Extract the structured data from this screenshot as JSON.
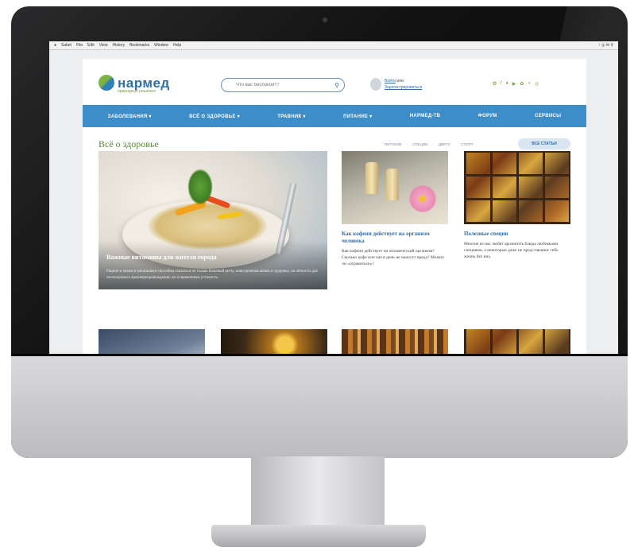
{
  "menubar": {
    "items": [
      "Safari",
      "File",
      "Edit",
      "View",
      "History",
      "Bookmarks",
      "Window",
      "Help"
    ]
  },
  "header": {
    "logo": "нармед",
    "logo_sub": "природные решения",
    "search_placeholder": "Что вас беспокоит?",
    "login": "Войти",
    "or": "или",
    "register": "Зарегистрироваться",
    "social_icons": [
      "odnoklassniki-icon",
      "facebook-icon",
      "twitter-icon",
      "youtube-icon",
      "vk-icon",
      "rss-icon",
      "instagram-icon"
    ]
  },
  "nav": {
    "items": [
      "ЗАБОЛЕВАНИЯ ▾",
      "ВСЁ О ЗДОРОВЬЕ ▾",
      "ТРАВНИК ▾",
      "ПИТАНИЕ ▾",
      "НАРМЕД-ТВ",
      "ФОРУМ",
      "СЕРВИСЫ"
    ]
  },
  "section": {
    "title": "Всё о здоровье",
    "links": [
      "ПИТАНИЕ",
      "·",
      "СПЕЦИИ",
      "·",
      "ДИЕТА",
      "·",
      "СПОРТ"
    ],
    "all_button": "ВСЕ СТАТЬИ"
  },
  "feature": {
    "title": "Важные витамины для жителя города",
    "text": "Рацион и жизнь в мегаполисе способны сказаться не только бешеный ритм, повседневная жизнь и здоровье, на лёгкости для полноценного времяпрепровождения, но и привычным усталость."
  },
  "cards": [
    {
      "title": "Как кофеин действует на организм человека",
      "text": "Как кофеин действует на человеческий организм? Сколько кофе или чая в день не наносут вреда? Можно ли «отравиться»?"
    },
    {
      "title": "Полезные специи",
      "text": "Многие из нас любят ароматить блюда любимыми специями, а некоторые даже не представляют себе жизнь без них."
    }
  ]
}
